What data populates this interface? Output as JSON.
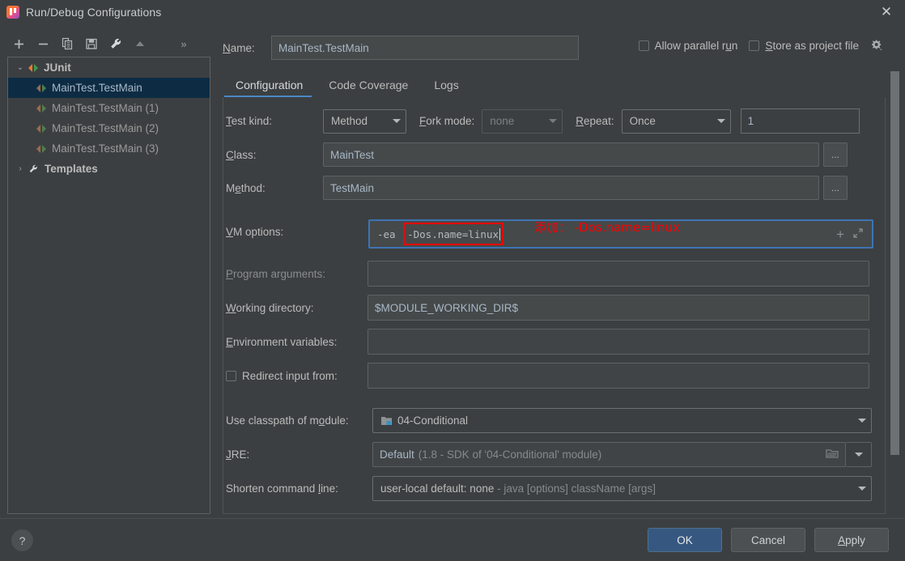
{
  "window": {
    "title": "Run/Debug Configurations",
    "app_icon": "intellij-idea-icon",
    "close_icon": "close-icon"
  },
  "toolbar": {
    "buttons": [
      {
        "name": "add-configuration-button",
        "icon": "plus-icon",
        "label": "+"
      },
      {
        "name": "remove-configuration-button",
        "icon": "minus-icon",
        "label": "−"
      },
      {
        "name": "copy-configuration-button",
        "icon": "copy-icon",
        "label": ""
      },
      {
        "name": "save-configuration-button",
        "icon": "save-icon",
        "label": ""
      },
      {
        "name": "edit-templates-button",
        "icon": "wrench-icon",
        "label": ""
      },
      {
        "name": "move-up-button",
        "icon": "arrow-up-icon",
        "label": ""
      },
      {
        "name": "more-options-button",
        "icon": "chevron-double-right-icon",
        "label": "»"
      }
    ]
  },
  "tree": {
    "nodes": [
      {
        "label": "JUnit",
        "type": "group",
        "expanded": true,
        "twisty": "⌄",
        "selected": false,
        "icon": "junit-icon"
      },
      {
        "label": "MainTest.TestMain",
        "type": "config",
        "selected": true,
        "icon": "junit-icon"
      },
      {
        "label": "MainTest.TestMain (1)",
        "type": "config",
        "selected": false,
        "icon": "junit-icon"
      },
      {
        "label": "MainTest.TestMain (2)",
        "type": "config",
        "selected": false,
        "icon": "junit-icon"
      },
      {
        "label": "MainTest.TestMain (3)",
        "type": "config",
        "selected": false,
        "icon": "junit-icon"
      },
      {
        "label": "Templates",
        "type": "group",
        "expanded": false,
        "twisty": "›",
        "selected": false,
        "icon": "wrench-icon"
      }
    ]
  },
  "name_row": {
    "label": "Name:",
    "mnemonic": "N",
    "value": "MainTest.TestMain"
  },
  "options": {
    "allow_parallel_run": {
      "label": "Allow parallel run",
      "mnemonic": "u",
      "checked": false
    },
    "store_as_project_file": {
      "label": "Store as project file",
      "mnemonic": "S",
      "checked": false
    },
    "gear_icon": "gear-dropdown-icon"
  },
  "tabs": [
    {
      "label": "Configuration",
      "active": true
    },
    {
      "label": "Code Coverage",
      "active": false
    },
    {
      "label": "Logs",
      "active": false
    }
  ],
  "form": {
    "test_kind": {
      "label": "Test kind:",
      "mnemonic": "T",
      "value": "Method"
    },
    "fork_mode": {
      "label": "Fork mode:",
      "mnemonic": "F",
      "value": "none",
      "disabled": true
    },
    "repeat": {
      "label": "Repeat:",
      "mnemonic": "R",
      "value": "Once"
    },
    "repeat_count": {
      "value": "1"
    },
    "class": {
      "label": "Class:",
      "mnemonic": "C",
      "value": "MainTest",
      "browse": "..."
    },
    "method": {
      "label": "Method:",
      "mnemonic": "e",
      "value": "TestMain",
      "browse": "..."
    },
    "vm_options": {
      "label": "VM options:",
      "mnemonic": "V",
      "prefix_value": "-ea ",
      "highlighted_value": "-Dos.name=linux",
      "full_value": "-ea -Dos.name=linux",
      "expand_icon": "expand-icon",
      "plus_icon": "plus-icon"
    },
    "annotation": {
      "text": "添加： -Dos.name=linux",
      "color": "#fe0000"
    },
    "program_arguments": {
      "label": "Program arguments:",
      "mnemonic": "P",
      "value": "",
      "disabled": true
    },
    "working_directory": {
      "label": "Working directory:",
      "mnemonic": "W",
      "value": "$MODULE_WORKING_DIR$",
      "folder_icon": "folder-icon"
    },
    "environment_variables": {
      "label": "Environment variables:",
      "mnemonic": "E",
      "value": "",
      "list_icon": "list-icon"
    },
    "redirect_input": {
      "label": "Redirect input from:",
      "checked": false,
      "value": "",
      "folder_icon": "folder-icon"
    },
    "use_classpath_of_module": {
      "label": "Use classpath of module:",
      "mnemonic": "o",
      "value": "04-Conditional",
      "icon": "module-icon"
    },
    "jre": {
      "label": "JRE:",
      "mnemonic": "J",
      "value": "Default",
      "hint": "(1.8 - SDK of '04-Conditional' module)",
      "folder_icon": "folder-icon"
    },
    "shorten_command_line": {
      "label": "Shorten command line:",
      "mnemonic": "l",
      "value": "user-local default: none",
      "hint": "- java [options] className [args]"
    }
  },
  "footer": {
    "help_label": "?",
    "ok_label": "OK",
    "cancel_label": "Cancel",
    "apply_label": "Apply"
  },
  "colors": {
    "background": "#3c3f41",
    "selection": "#0d2c44",
    "accent": "#4a88c7",
    "primary_button": "#365880",
    "annotation_red": "#fe0000",
    "focus_border": "#3c74b4"
  }
}
